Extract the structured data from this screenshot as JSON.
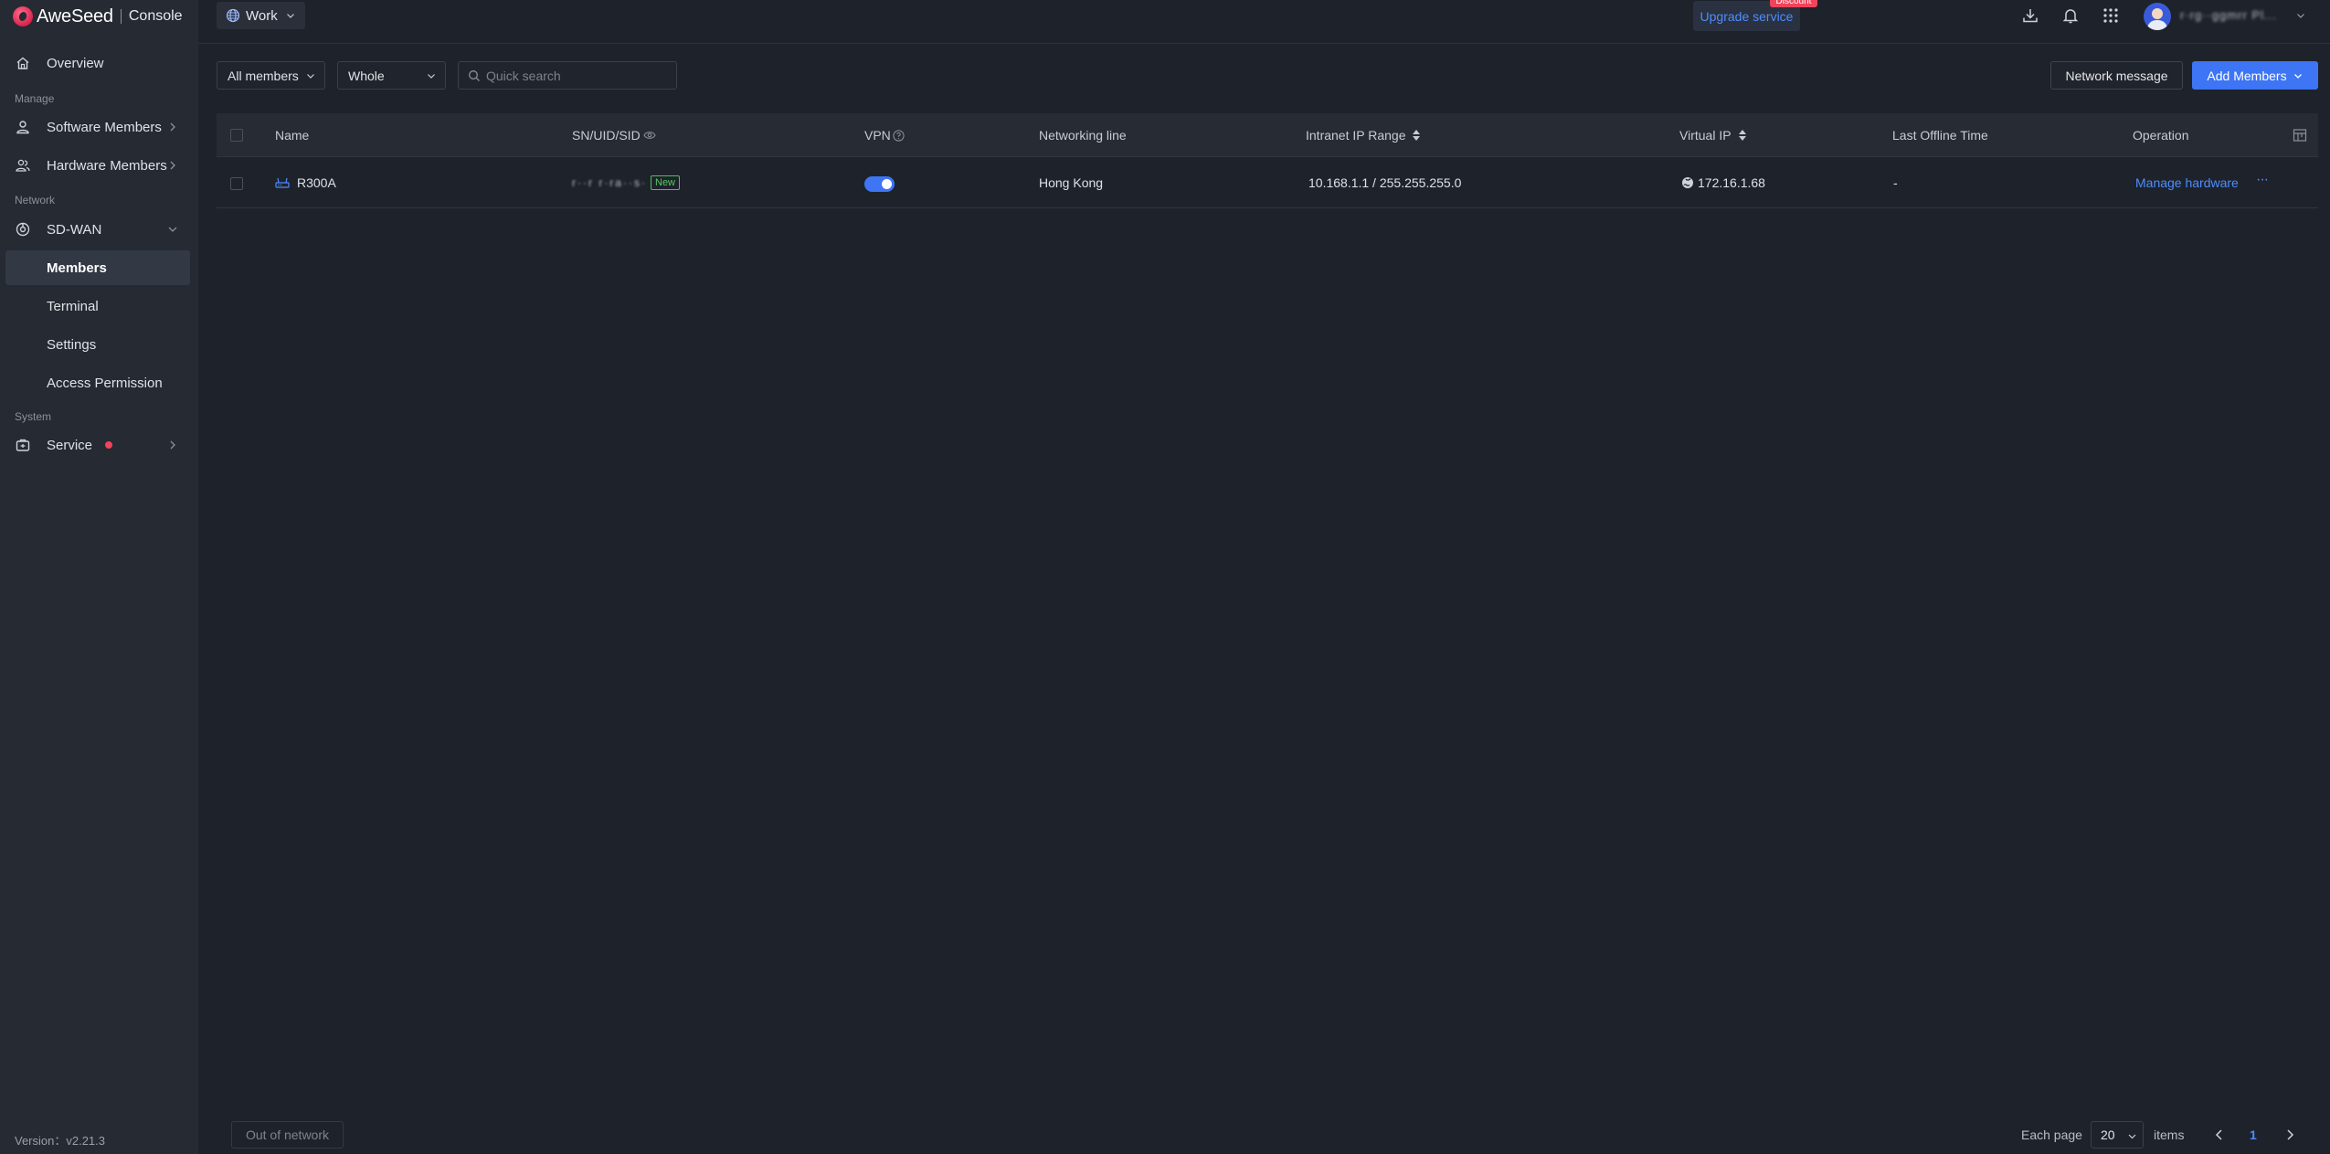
{
  "brand": {
    "name": "AweSeed",
    "console": "Console"
  },
  "sidebar": {
    "overview": "Overview",
    "sections": {
      "manage": "Manage",
      "network": "Network",
      "system": "System"
    },
    "software_members": "Software Members",
    "hardware_members": "Hardware Members",
    "sdwan": "SD-WAN",
    "members": "Members",
    "terminal": "Terminal",
    "settings": "Settings",
    "access_permission": "Access Permission",
    "service": "Service",
    "version": "Version：v2.21.3"
  },
  "topbar": {
    "workspace": "Work",
    "upgrade": "Upgrade service",
    "discount": "Discount",
    "username": "r·rg··ggmrr Pl..."
  },
  "toolbar": {
    "member_filter": "All members",
    "scope_filter": "Whole",
    "search_placeholder": "Quick search",
    "network_message": "Network message",
    "add_members": "Add Members"
  },
  "table": {
    "columns": {
      "name": "Name",
      "sn": "SN/UID/SID",
      "vpn": "VPN",
      "line": "Networking line",
      "intranet": "Intranet IP Range",
      "virtual_ip": "Virtual IP",
      "last_offline": "Last Offline Time",
      "operation": "Operation"
    },
    "rows": [
      {
        "name": "R300A",
        "sn": "r··r r·ra··s·a",
        "badge": "New",
        "vpn_on": true,
        "line": "Hong Kong",
        "intranet": "10.168.1.1 / 255.255.255.0",
        "virtual_ip": "172.16.1.68",
        "last_offline": "-",
        "action": "Manage hardware",
        "more": "···"
      }
    ]
  },
  "footer": {
    "out_of_network": "Out of network",
    "each_page": "Each page",
    "page_size": "20",
    "items": "items",
    "current_page": "1"
  },
  "colors": {
    "accent": "#3d75f5",
    "link": "#4d8dff",
    "alert": "#f0445a",
    "badge_new": "#57c864"
  }
}
